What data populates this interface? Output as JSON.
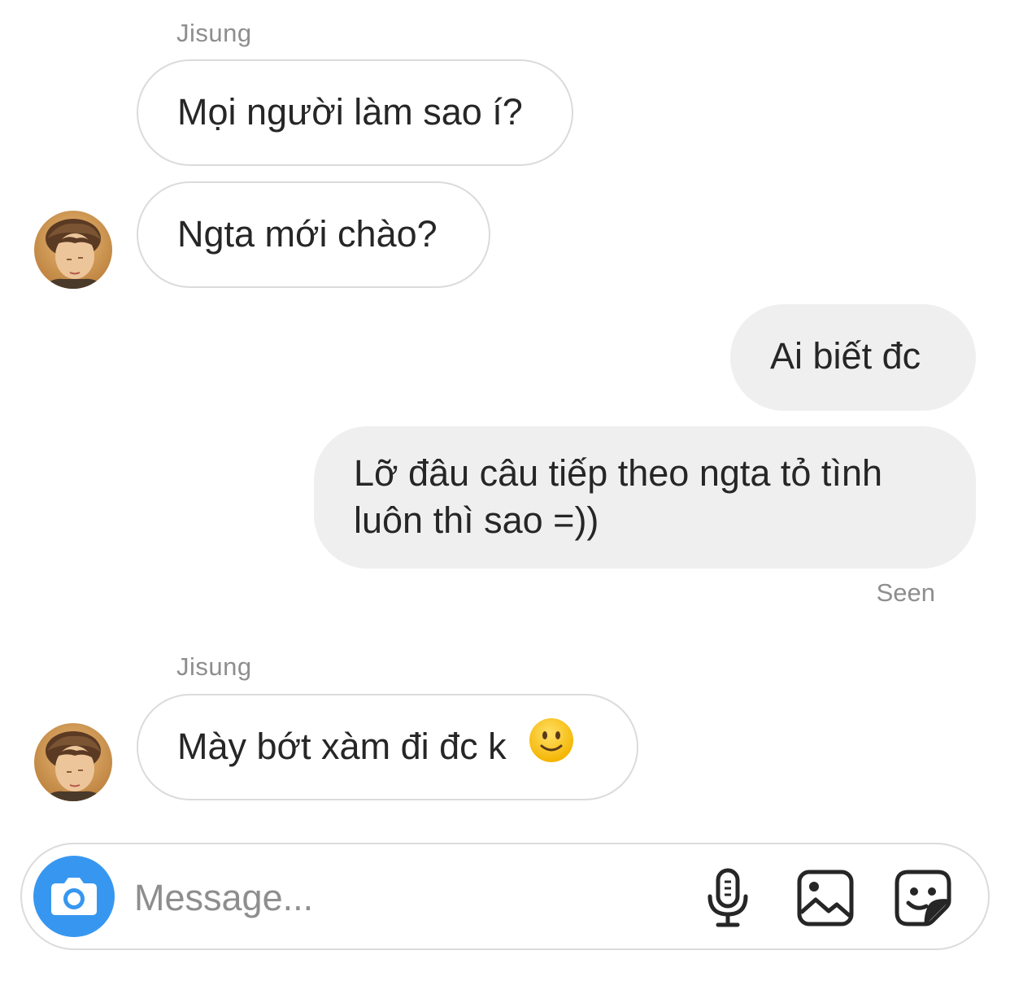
{
  "thread": {
    "messages": [
      {
        "sender": "Jisung",
        "text": "Mọi người làm sao í?"
      },
      {
        "text": "Ngta mới chào?"
      },
      {
        "text": "Ai biết đc"
      },
      {
        "text_line1": "Lỡ đâu câu tiếp theo ngta tỏ tình",
        "text_line2": "luôn thì sao =))"
      },
      {
        "sender": "Jisung",
        "text": "Mày bớt xàm đi đc k"
      }
    ],
    "seen_label": "Seen"
  },
  "composer": {
    "placeholder": "Message...",
    "icons": [
      "camera-icon",
      "microphone-icon",
      "gallery-icon",
      "sticker-icon"
    ]
  },
  "colors": {
    "accent": "#3797f0",
    "outgoing_bubble": "#efefef",
    "bubble_border": "#dbdbdb",
    "muted_text": "#8e8e8e",
    "text": "#262626"
  }
}
